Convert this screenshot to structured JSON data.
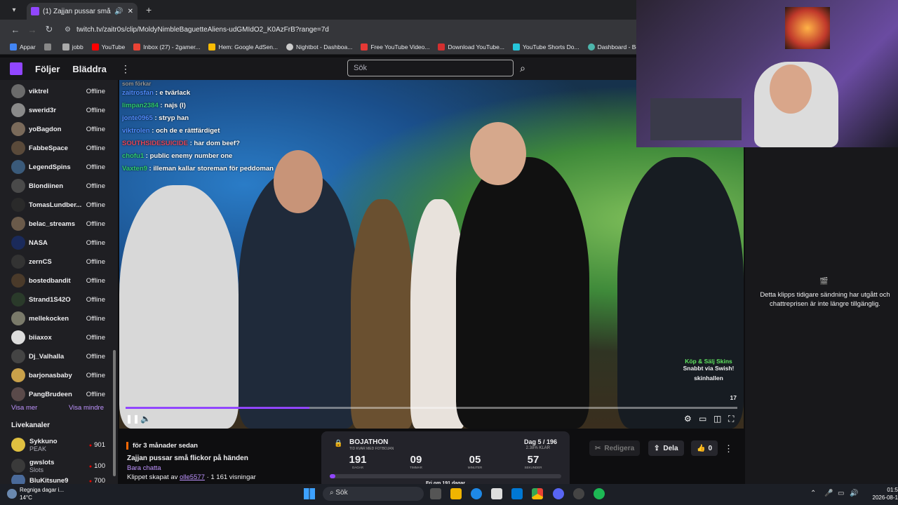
{
  "browser": {
    "tab_title": "(1) Zajjan pussar små flickor",
    "url": "twitch.tv/zaitr0s/clip/MoldyNimbleBaguetteAliens-udGMIdO2_K0AzFrB?range=7d",
    "bookmarks": [
      "Appar",
      "jobb",
      "YouTube",
      "Inbox (27) - 2gamer...",
      "Hem: Google AdSen...",
      "Nightbot - Dashboa...",
      "Free YouTube Video...",
      "Download YouTube...",
      "YouTube Shorts Do...",
      "Dashboard - BeastN..."
    ]
  },
  "twitch_nav": {
    "following": "Följer",
    "browse": "Bläddra",
    "search_placeholder": "Sök"
  },
  "sidebar": {
    "channels": [
      {
        "name": "viktrel",
        "status": "Offline"
      },
      {
        "name": "swerid3r",
        "status": "Offline"
      },
      {
        "name": "yoBagdon",
        "status": "Offline"
      },
      {
        "name": "FabbeSpace",
        "status": "Offline"
      },
      {
        "name": "LegendSpins",
        "status": "Offline"
      },
      {
        "name": "Blondiinen",
        "status": "Offline"
      },
      {
        "name": "TomasLundber...",
        "status": "Offline"
      },
      {
        "name": "belac_streams",
        "status": "Offline"
      },
      {
        "name": "NASA",
        "status": "Offline"
      },
      {
        "name": "zernCS",
        "status": "Offline"
      },
      {
        "name": "bostedbandit",
        "status": "Offline"
      },
      {
        "name": "Strand1S42O",
        "status": "Offline"
      },
      {
        "name": "mellekocken",
        "status": "Offline"
      },
      {
        "name": "biiaxox",
        "status": "Offline"
      },
      {
        "name": "Dj_Valhalla",
        "status": "Offline"
      },
      {
        "name": "barjonasbaby",
        "status": "Offline"
      },
      {
        "name": "PangBrudeen",
        "status": "Offline"
      }
    ],
    "show_more": "Visa mer",
    "show_less": "Visa mindre",
    "live_header": "Livekanaler",
    "live": [
      {
        "name": "Sykkuno",
        "game": "PEAK",
        "viewers": "901"
      },
      {
        "name": "gwslots",
        "game": "Slots",
        "viewers": "100"
      },
      {
        "name": "BluKitsune9",
        "game": "",
        "viewers": "700"
      }
    ]
  },
  "video_chat": [
    {
      "user": "som förkar",
      "msg": ""
    },
    {
      "user": "zaitrosfan",
      "msg": "e tvärlack"
    },
    {
      "user": "limpan2384",
      "msg": "najs (l)"
    },
    {
      "user": "jonte0965",
      "msg": "stryp han"
    },
    {
      "user": "viktrolen",
      "msg": "och de e rättfärdiget"
    },
    {
      "user": "SOUTHSIDESUICIDE",
      "msg": "har dom beef?"
    },
    {
      "user": "chofu1",
      "msg": "public enemy number one"
    },
    {
      "user": "Vaxten9",
      "msg": "illeman kallar storeman för peddoman"
    }
  ],
  "ad": {
    "line1": "Köp & Sälj Skins",
    "line2": "Snabbt via Swish!",
    "brand": "skinhallen",
    "badge": "17"
  },
  "video_progress": 0.3,
  "right_panel": {
    "message": "Detta klipps tidigare sändning har utgått och chattreprisen är inte längre tillgänglig."
  },
  "clip_info": {
    "time_ago": "för 3 månader sedan",
    "title": "Zajjan pussar små flickor på händen",
    "category": "Bara chatta",
    "created_prefix": "Klippet skapat av",
    "creator": "olle5577",
    "views": "· 1 161 visningar",
    "edit": "Redigera",
    "share": "Dela",
    "likes": "0"
  },
  "bojathon": {
    "title": "BOJATHON",
    "subtitle": "TID KVAR MED FOTBOJAN",
    "day": "Dag 5 / 196",
    "pct": "2.38% KLAR",
    "days": "191",
    "days_label": "DAGAR",
    "hours": "09",
    "hours_label": "TIMMAR",
    "minutes": "05",
    "minutes_label": "MINUTER",
    "seconds": "57",
    "seconds_label": "SEKUNDER",
    "footer": "Fri om 191 dagar"
  },
  "taskbar": {
    "weather_title": "Regniga dagar i...",
    "weather_temp": "14°C",
    "search": "Sök",
    "time": "01:5",
    "date": "2026-08-1"
  }
}
